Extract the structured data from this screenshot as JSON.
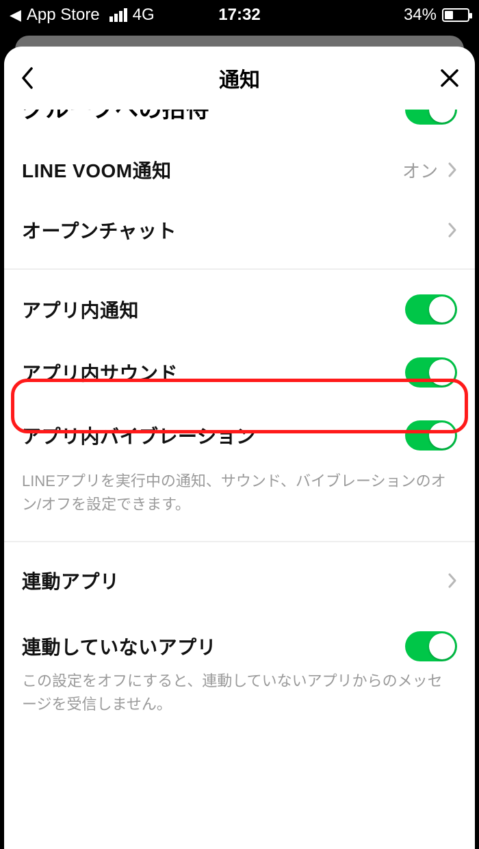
{
  "status": {
    "back_app": "App Store",
    "network": "4G",
    "time": "17:32",
    "battery_pct": "34%"
  },
  "nav": {
    "title": "通知"
  },
  "rows": {
    "cutoff_label": "グループへの招待",
    "line_voom": {
      "label": "LINE VOOM通知",
      "value": "オン"
    },
    "openchat": {
      "label": "オープンチャット"
    },
    "in_app_notif": {
      "label": "アプリ内通知"
    },
    "in_app_sound": {
      "label": "アプリ内サウンド"
    },
    "in_app_vibe": {
      "label": "アプリ内バイブレーション"
    },
    "in_app_desc": "LINEアプリを実行中の通知、サウンド、バイブレーションのオン/オフを設定できます。",
    "linked_apps": {
      "label": "連動アプリ"
    },
    "unlinked_apps": {
      "label": "連動していないアプリ"
    },
    "unlinked_desc": "この設定をオフにすると、連動していないアプリからのメッセージを受信しません。"
  }
}
